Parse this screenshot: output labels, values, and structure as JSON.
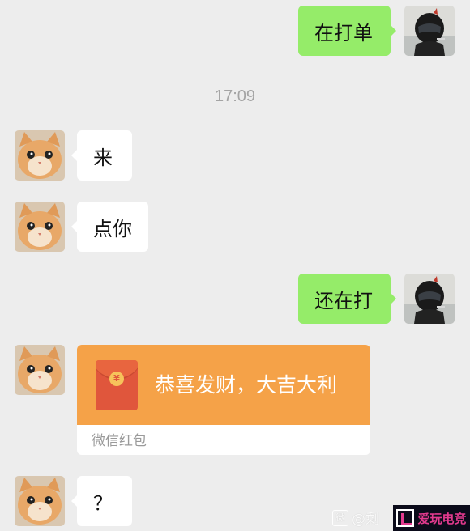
{
  "messages": [
    {
      "side": "out",
      "text": "在打单"
    },
    {
      "side": "in",
      "text": "来"
    },
    {
      "side": "in",
      "text": "点你"
    },
    {
      "side": "out",
      "text": "还在打"
    },
    {
      "side": "in",
      "text": "？"
    }
  ],
  "timestamp": "17:09",
  "red_packet": {
    "title": "恭喜发财，大吉大利",
    "footer": "微信红包",
    "coin_symbol": "¥",
    "color": "#f5a248"
  },
  "watermark": {
    "icon_text": "微",
    "text": "@剩"
  },
  "logo": {
    "text": "爱玩电竞"
  },
  "colors": {
    "background": "#ededed",
    "outgoing_bubble": "#95ec69",
    "incoming_bubble": "#ffffff"
  }
}
